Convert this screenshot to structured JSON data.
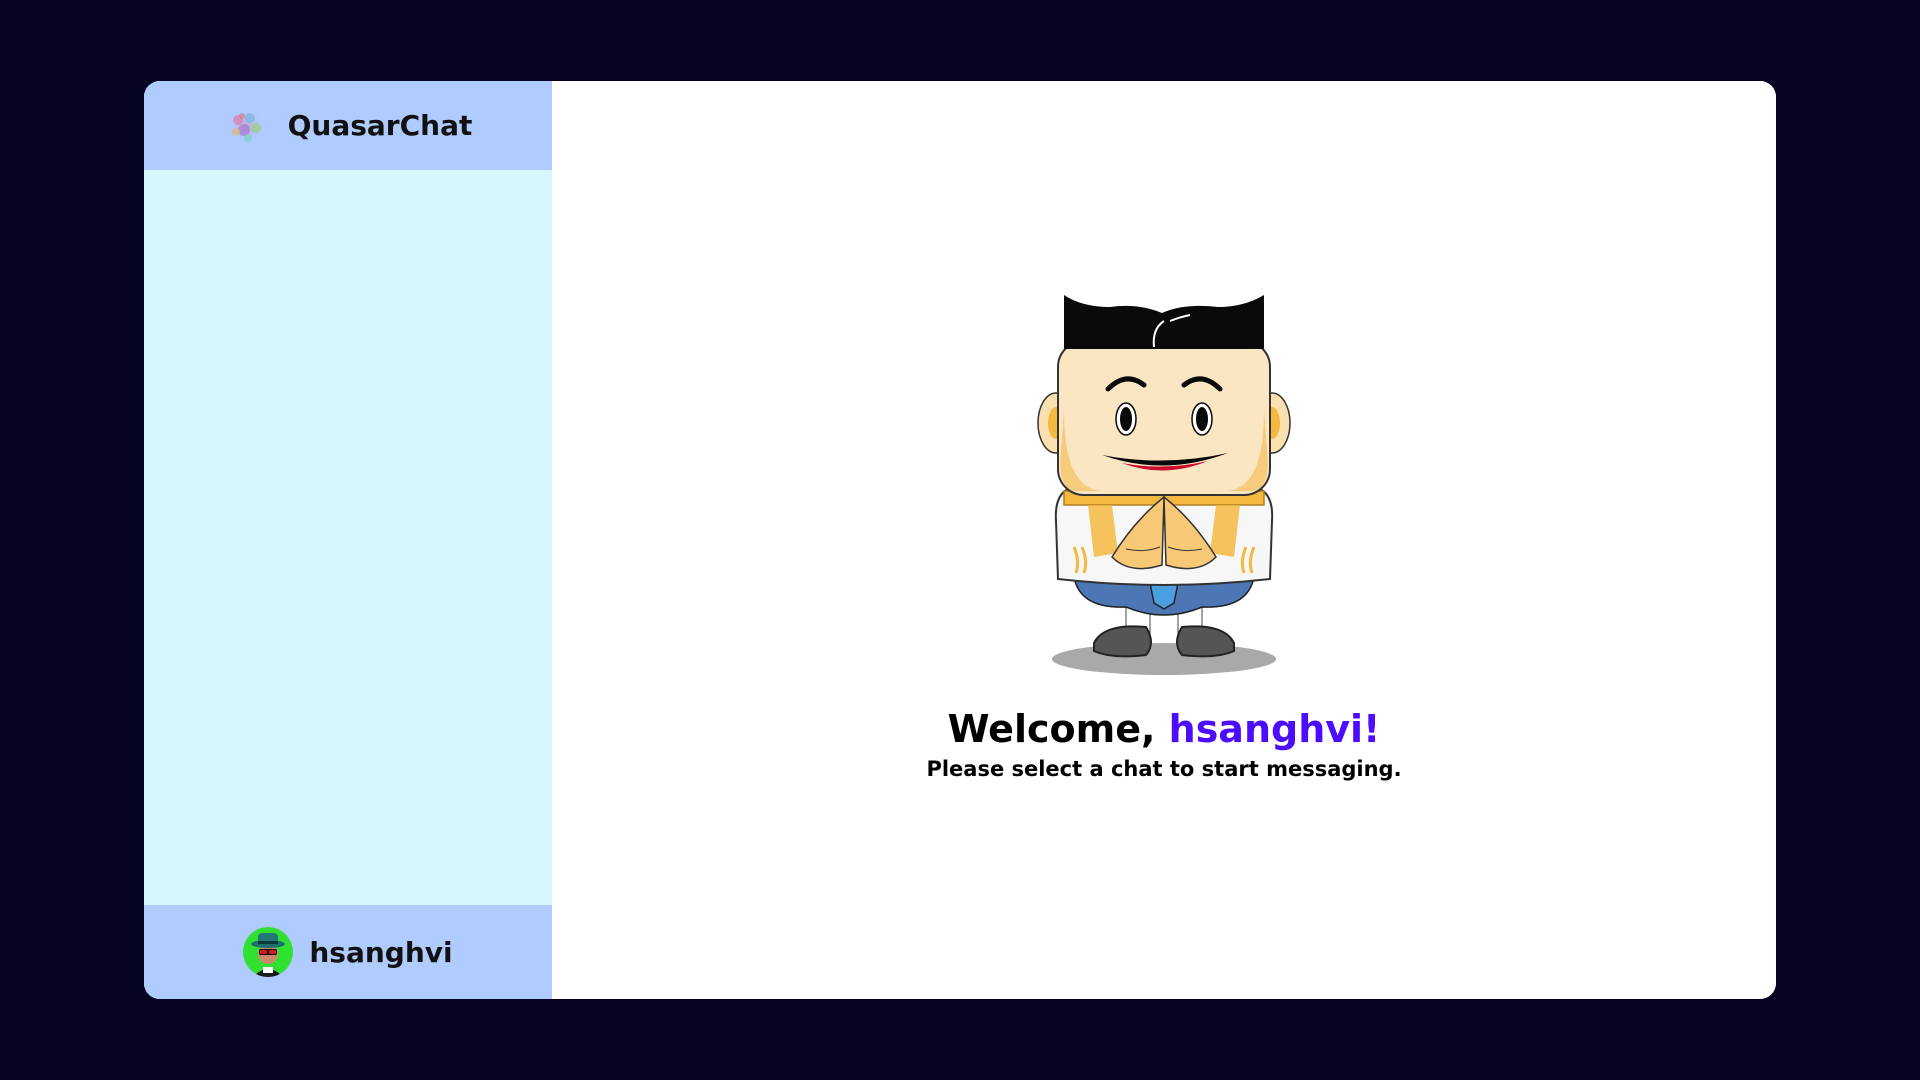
{
  "app": {
    "title": "QuasarChat",
    "logo_icon": "quasar-logo-icon"
  },
  "user": {
    "username": "hsanghvi",
    "avatar_icon": "user-avatar-icon"
  },
  "welcome": {
    "greeting": "Welcome, ",
    "name": "hsanghvi!",
    "subtitle": "Please select a chat to start messaging.",
    "illustration_icon": "greeting-mascot-icon"
  },
  "colors": {
    "background": "#070322",
    "sidebar_header": "#b0ccff",
    "sidebar_body": "#d6f7fe",
    "accent": "#4c0dff"
  }
}
